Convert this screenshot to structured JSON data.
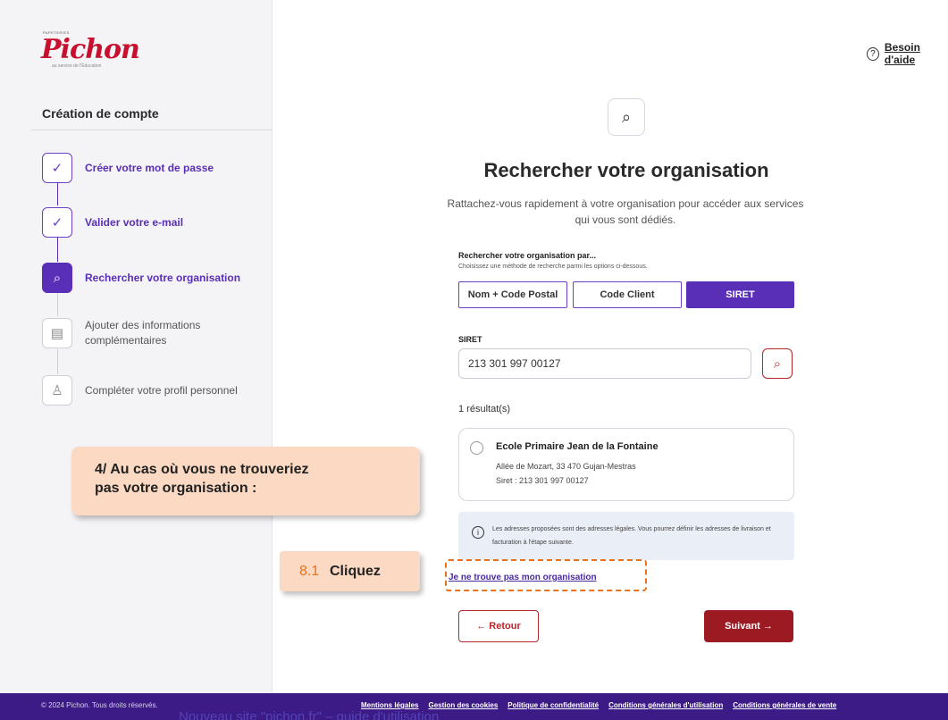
{
  "logo": {
    "top_text": "PAPETERIES",
    "brand": "Pichon",
    "tagline": "au service de l'Éducation"
  },
  "help": {
    "icon": "?",
    "label": "Besoin d'aide"
  },
  "sidebar": {
    "title": "Création de compte",
    "steps": [
      {
        "label": "Créer votre mot de passe",
        "state": "done",
        "icon": "check-circle-icon"
      },
      {
        "label": "Valider votre e-mail",
        "state": "done",
        "icon": "check-circle-icon"
      },
      {
        "label": "Rechercher votre organisation",
        "state": "active",
        "icon": "search-icon"
      },
      {
        "label": "Ajouter des informations complémentaires",
        "state": "todo",
        "icon": "document-icon"
      },
      {
        "label": "Compléter votre profil personnel",
        "state": "todo",
        "icon": "user-edit-icon"
      }
    ]
  },
  "main": {
    "title": "Rechercher votre organisation",
    "subtitle": "Rattachez-vous rapidement à votre organisation pour accéder aux services qui vous sont dédiés.",
    "search_by": {
      "title": "Rechercher votre organisation par...",
      "hint": "Choisissez une méthode de recherche parmi les options ci-dessous.",
      "options": [
        "Nom + Code Postal",
        "Code Client",
        "SIRET"
      ],
      "selected": "SIRET"
    },
    "siret": {
      "label": "SIRET",
      "value": "213 301 997 00127"
    },
    "results_count": "1 résultat(s)",
    "result": {
      "name": "Ecole Primaire Jean de la Fontaine",
      "address": "Allée de Mozart, 33 470 Gujan-Mestras",
      "siret": "Siret : 213 301 997 00127"
    },
    "info": "Les adresses proposées sont des adresses légales. Vous pourrez définir les adresses de livraison et facturation à l'étape suivante.",
    "not_found_link": "Je ne trouve pas mon organisation",
    "back_label": "← Retour",
    "next_label": "Suivant →"
  },
  "callouts": {
    "step_note": "4/ Au cas où vous ne trouveriez pas votre organisation :",
    "click_num": "8.1",
    "click_word": "Cliquez"
  },
  "footer": {
    "copyright": "© 2024 Pichon. Tous droits réservés.",
    "links": [
      "Mentions légales",
      "Gestion des cookies",
      "Politique de confidentialité",
      "Conditions générales d'utilisation",
      "Conditions générales de vente"
    ],
    "overlay": "Nouveau site \"pichon.fr\" – guide d'utilisation"
  },
  "colors": {
    "primary": "#5a2fb8",
    "danger": "#9c1b22",
    "accent": "#e8711e",
    "footer": "#3d1b86"
  }
}
